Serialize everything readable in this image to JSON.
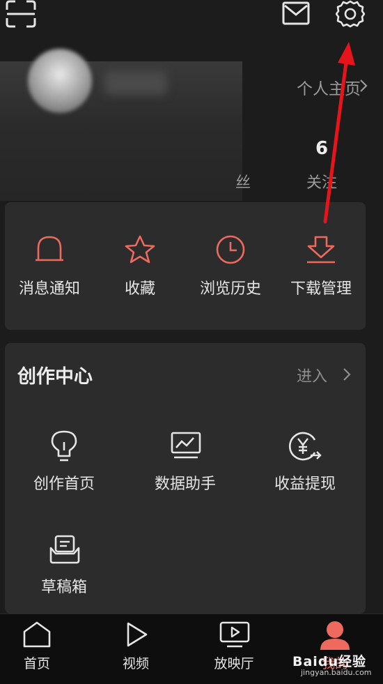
{
  "header": {
    "scan_icon": "scan-icon",
    "message_icon": "envelope-icon",
    "settings_icon": "gear-icon"
  },
  "profile": {
    "homepage_link": "个人主页",
    "stats": [
      {
        "value": "6",
        "label": "关注"
      }
    ],
    "partial_stat_label": "丝"
  },
  "quick_actions": [
    {
      "label": "消息通知",
      "icon": "bell-icon"
    },
    {
      "label": "收藏",
      "icon": "star-icon"
    },
    {
      "label": "浏览历史",
      "icon": "clock-icon"
    },
    {
      "label": "下载管理",
      "icon": "download-icon"
    }
  ],
  "creator_center": {
    "title": "创作中心",
    "enter_label": "进入",
    "items": [
      {
        "label": "创作首页",
        "icon": "lightbulb-icon"
      },
      {
        "label": "数据助手",
        "icon": "chart-monitor-icon"
      },
      {
        "label": "收益提现",
        "icon": "yuan-coin-icon"
      },
      {
        "label": "草稿箱",
        "icon": "draft-box-icon"
      }
    ]
  },
  "bottom_nav": [
    {
      "label": "首页",
      "icon": "home-icon"
    },
    {
      "label": "视频",
      "icon": "play-icon"
    },
    {
      "label": "放映厅",
      "icon": "tv-play-icon"
    },
    {
      "label": "我的",
      "icon": "profile-icon"
    }
  ],
  "watermark": {
    "text": "Baidu经验",
    "url_text": "jingyan.baidu.com"
  },
  "colors": {
    "accent": "#ee6a5e",
    "annotation_arrow": "#e8141c",
    "background": "#1c1c1c",
    "card": "#2c2c2c"
  }
}
